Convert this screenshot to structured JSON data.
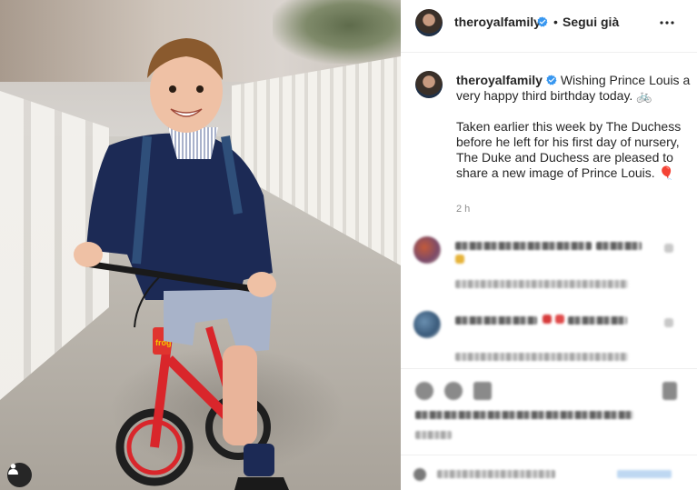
{
  "post": {
    "author": "theroyalfamily",
    "verified": true,
    "separator": "•",
    "follow_label": "Segui già",
    "more_icon": "more-horizontal-icon",
    "caption_para1": "Wishing Prince Louis a very happy third birthday today. 🚲",
    "caption_para2": "Taken earlier this week by The Duchess before he left for his first day of nursery, The Duke and Duchess are pleased to share a new image of Prince Louis. 🎈",
    "timestamp": "2 h"
  },
  "colors": {
    "verified_blue": "#3897f0",
    "text_primary": "#262626",
    "text_secondary": "#8e8e8e",
    "divider": "#efefef"
  },
  "photo": {
    "user_tag_icon": "user-tag-icon"
  }
}
